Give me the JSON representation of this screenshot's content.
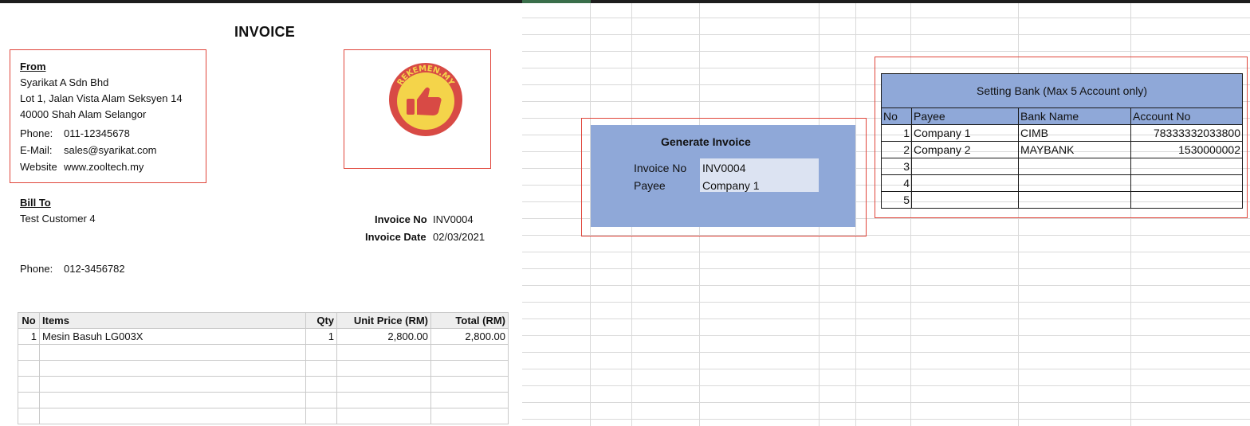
{
  "invoice": {
    "title": "INVOICE",
    "from": {
      "heading": "From",
      "company": "Syarikat A Sdn Bhd",
      "address1": "Lot 1, Jalan Vista Alam Seksyen 14",
      "address2": "40000 Shah Alam Selangor",
      "phone_label": "Phone:",
      "phone": "011-12345678",
      "email_label": "E-Mail:",
      "email": "sales@syarikat.com",
      "website_label": "Website",
      "website": "www.zooltech.my"
    },
    "logo_text": "REKEMEN.MY",
    "bill_to": {
      "heading": "Bill To",
      "customer": "Test Customer 4",
      "phone_label": "Phone:",
      "phone": "012-3456782"
    },
    "meta": {
      "invoice_no_label": "Invoice No",
      "invoice_no": "INV0004",
      "invoice_date_label": "Invoice Date",
      "invoice_date": "02/03/2021"
    },
    "table": {
      "headers": [
        "No",
        "Items",
        "Qty",
        "Unit Price (RM)",
        "Total (RM)"
      ],
      "rows": [
        {
          "no": "1",
          "item": "Mesin Basuh LG003X",
          "qty": "1",
          "unit_price": "2,800.00",
          "total": "2,800.00"
        }
      ]
    }
  },
  "generate": {
    "title": "Generate Invoice",
    "invoice_no_label": "Invoice No",
    "invoice_no": "INV0004",
    "payee_label": "Payee",
    "payee": "Company 1"
  },
  "bank": {
    "title": "Setting Bank (Max 5 Account only)",
    "headers": [
      "No",
      "Payee",
      "Bank Name",
      "Account No"
    ],
    "rows": [
      {
        "no": "1",
        "payee": "Company 1",
        "bank": "CIMB",
        "account": "78333332033800"
      },
      {
        "no": "2",
        "payee": "Company 2",
        "bank": "MAYBANK",
        "account": "1530000002"
      },
      {
        "no": "3",
        "payee": "",
        "bank": "",
        "account": ""
      },
      {
        "no": "4",
        "payee": "",
        "bank": "",
        "account": ""
      },
      {
        "no": "5",
        "payee": "",
        "bank": "",
        "account": ""
      }
    ]
  },
  "colors": {
    "accent_red": "#e0453a",
    "panel_blue": "#8fa8d8",
    "field_blue": "#dce3f2"
  }
}
